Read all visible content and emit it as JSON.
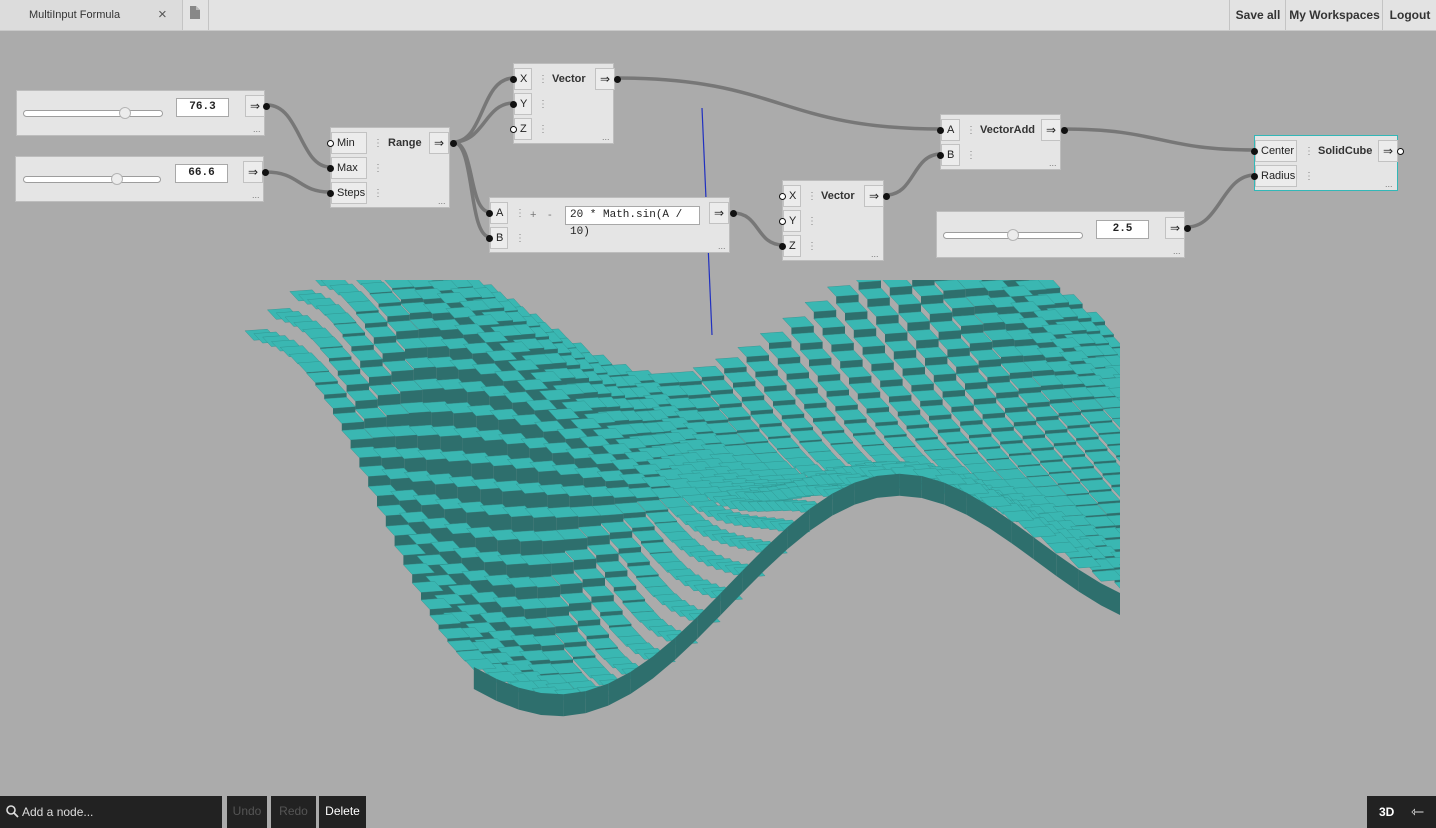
{
  "tab": {
    "title": "MultiInput Formula",
    "close_icon": "×"
  },
  "topbar": {
    "save_all": "Save all",
    "my_workspaces": "My Workspaces",
    "logout": "Logout"
  },
  "nodes": {
    "slider1": {
      "value": "76.3",
      "level": 0.75
    },
    "slider2": {
      "value": "66.6",
      "level": 0.7
    },
    "slider3": {
      "value": "2.5",
      "level": 0.5
    },
    "range": {
      "title": "Range",
      "inputs": [
        "Min",
        "Max",
        "Steps"
      ]
    },
    "vector1": {
      "title": "Vector",
      "inputs": [
        "X",
        "Y",
        "Z"
      ]
    },
    "formula": {
      "inputs": [
        "A",
        "B"
      ],
      "plus": "+",
      "minus": "-",
      "expression": "20 * Math.sin(A / 10)"
    },
    "vector2": {
      "title": "Vector",
      "inputs": [
        "X",
        "Y",
        "Z"
      ]
    },
    "vectoradd": {
      "title": "VectorAdd",
      "inputs": [
        "A",
        "B"
      ]
    },
    "solidcube": {
      "title": "SolidCube",
      "inputs": [
        "Center",
        "Radius"
      ]
    },
    "output_glyph": "⇒",
    "more_glyph": "..."
  },
  "bottombar": {
    "search_placeholder": "Add a node...",
    "undo": "Undo",
    "redo": "Redo",
    "delete": "Delete",
    "view_mode": "3D",
    "toggle_icon": "⇽"
  },
  "colors": {
    "accent": "#32b8b8",
    "surface_top": "#3ab7b2",
    "surface_side": "#2e6f6d",
    "background": "#ababab"
  }
}
